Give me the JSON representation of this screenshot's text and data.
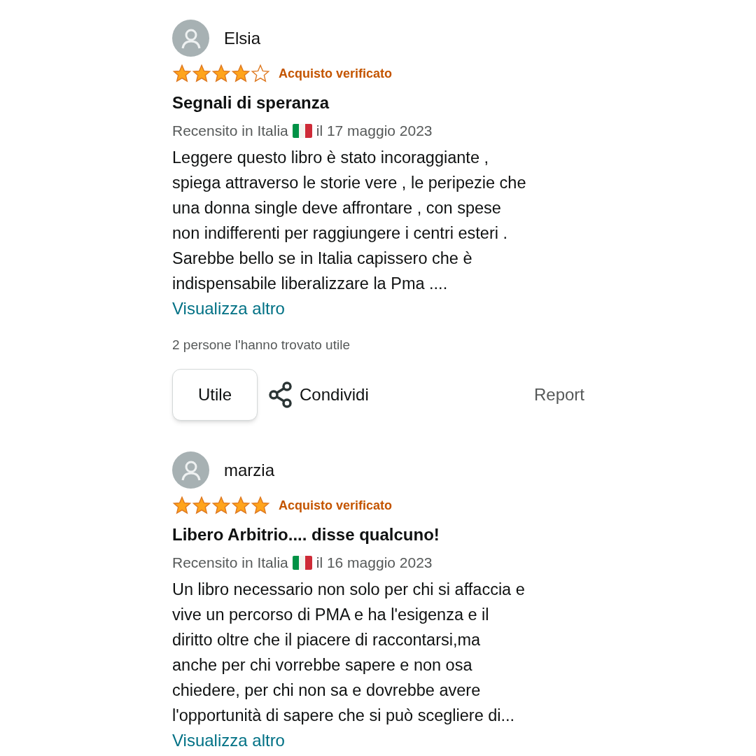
{
  "reviews": [
    {
      "author": "Elsia",
      "stars": 4,
      "verified": "Acquisto verificato",
      "title": "Segnali di speranza",
      "reviewed_in": "Recensito in Italia",
      "date": "il 17 maggio 2023",
      "body_lines": [
        "Leggere questo libro è stato incoraggiante ,",
        "spiega attraverso le storie vere , le peripezie che",
        "una donna single deve affrontare , con spese",
        "non indifferenti per raggiungere i centri esteri .",
        "Sarebbe bello se in Italia capissero che è",
        "indispensabile liberalizzare la Pma ...."
      ],
      "more": "Visualizza altro",
      "helpful_count": "2 persone l'hanno trovato utile",
      "actions": {
        "helpful": "Utile",
        "share": "Condividi",
        "report": "Report"
      }
    },
    {
      "author": "marzia",
      "stars": 5,
      "verified": "Acquisto verificato",
      "title": "Libero Arbitrio.... disse qualcuno!",
      "reviewed_in": "Recensito in Italia",
      "date": "il 16 maggio 2023",
      "body_lines": [
        "Un libro necessario non solo per chi si affaccia e",
        "vive un percorso di PMA e ha l'esigenza e il",
        "diritto oltre che il piacere di raccontarsi,ma",
        "anche per chi vorrebbe sapere e non osa",
        "chiedere, per chi non sa e dovrebbe avere",
        "l'opportunità di sapere che si può scegliere di..."
      ],
      "more": "Visualizza altro"
    }
  ]
}
